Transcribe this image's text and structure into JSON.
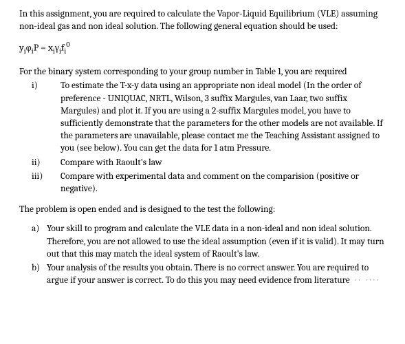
{
  "intro": "In this assignment, you are required to calculate the Vapor-Liquid Equilibrium (VLE) assuming non-ideal gas and non ideal solution. The following general equation should be used:",
  "equation": {
    "lhs_y": "y",
    "lhs_phi": "φ",
    "lhs_P": "P",
    "eq": " = ",
    "rhs_x": "x",
    "rhs_gamma": "γ",
    "rhs_f": "f",
    "sub_i": "i",
    "sup_0": "0"
  },
  "binary_intro": "For the binary system corresponding to your group number in Table 1,  you are required",
  "items": [
    {
      "marker": "i)",
      "text": "To estimate the T-x-y data using an appropriate non ideal model  (In the order of preference - UNIQUAC, NRTL, Wilson, 3 suffix Margules, van Laar, two suffix Margules) and plot it. If you are using a 2-suffix Margules model, you have to sufficiently demonstrate that the parameters for the other models are not available. If the parameters are unavailable, please contact me the Teaching Assistant assigned to you (see below). You can get the data for 1 atm Pressure."
    },
    {
      "marker": "ii)",
      "text": "Compare with Raoult's law"
    },
    {
      "marker": "iii)",
      "text": "Compare with experimental data and comment on the comparision (positive or negative)."
    }
  ],
  "tests_intro": "The problem is open ended and is designed to the test the following:",
  "tests": [
    {
      "marker": "a)",
      "text": "Your skill to program and calculate the VLE data in a non-ideal and non ideal solution.  Therefore, you are not allowed to use the ideal assumption (even if it is valid). It may turn out that this may match the ideal system of Raoult's law."
    },
    {
      "marker": "b)",
      "text": "Your analysis of the results you obtain. There is no correct answer. You are required to argue if your answer is correct. To do this you may need evidence from literature"
    }
  ]
}
